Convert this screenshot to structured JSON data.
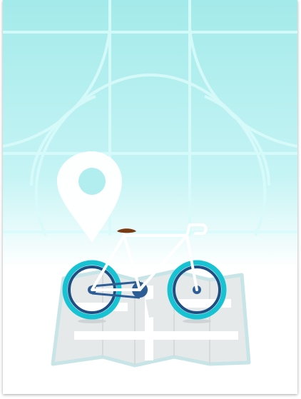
{
  "illustration": {
    "subject": "bike-on-map",
    "colors": {
      "sky_top": "#a4eaea",
      "sky_bottom": "#ffffff",
      "grid_lines": "#d9fbfb",
      "pin": "#ffffff",
      "tire": "#17c3d3",
      "rim": "#1f4f82",
      "hub": "#2c5d94",
      "seat": "#7a3b12",
      "frame": "#ffffff",
      "map_fill": "#e6e9ea",
      "map_border": "#c7e4e7",
      "map_road": "#ffffff"
    }
  }
}
